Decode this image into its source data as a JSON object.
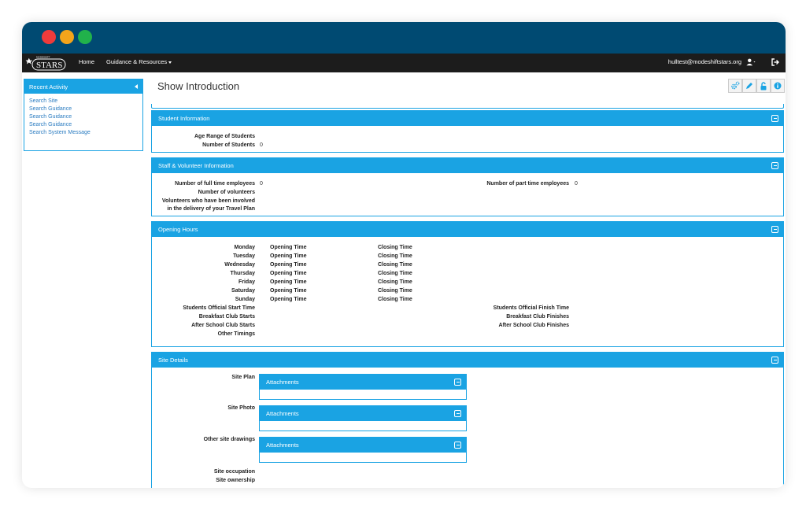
{
  "window": {
    "traffic_lights": [
      "close",
      "minimize",
      "maximize"
    ]
  },
  "navbar": {
    "logo_text": "STARS",
    "logo_subtext": "MODESHIFT",
    "home": "Home",
    "guidance": "Guidance & Resources",
    "user_email": "hulltest@modeshiftstars.org"
  },
  "sidebar": {
    "title": "Recent Activity",
    "items": [
      "Search Site",
      "Search Guidance",
      "Search Guidance",
      "Search Guidance",
      "Search System Message"
    ]
  },
  "page": {
    "title": "Show Introduction",
    "toolbar": [
      "settings-icon",
      "edit-icon",
      "unlock-icon",
      "info-icon"
    ]
  },
  "student_info": {
    "title": "Student Information",
    "age_range_label": "Age Range of Students",
    "num_students_label": "Number of Students",
    "num_students_value": "0"
  },
  "staff_info": {
    "title": "Staff & Volunteer Information",
    "full_time_label": "Number of full time employees",
    "full_time_value": "0",
    "volunteers_label": "Number of volunteers",
    "travel_plan_label_1": "Volunteers who have been involved",
    "travel_plan_label_2": "in the delivery of your Travel Plan",
    "part_time_label": "Number of part time employees",
    "part_time_value": "0"
  },
  "opening_hours": {
    "title": "Opening Hours",
    "opening_label": "Opening Time",
    "closing_label": "Closing Time",
    "days": [
      "Monday",
      "Tuesday",
      "Wednesday",
      "Thursday",
      "Friday",
      "Saturday",
      "Sunday"
    ],
    "official_start": "Students Official Start Time",
    "breakfast_starts": "Breakfast Club Starts",
    "after_school_starts": "After School Club Starts",
    "other_timings": "Other Timings",
    "official_finish": "Students Official Finish Time",
    "breakfast_finishes": "Breakfast Club Finishes",
    "after_school_finishes": "After School Club Finishes"
  },
  "site_details": {
    "title": "Site Details",
    "site_plan": "Site Plan",
    "site_photo": "Site Photo",
    "other_drawings": "Other site drawings",
    "attachments": "Attachments",
    "occupation": "Site occupation",
    "ownership": "Site ownership"
  },
  "colors": {
    "accent": "#1aa3e3",
    "titlebar": "#004a72",
    "navbar": "#1c1c1c"
  }
}
